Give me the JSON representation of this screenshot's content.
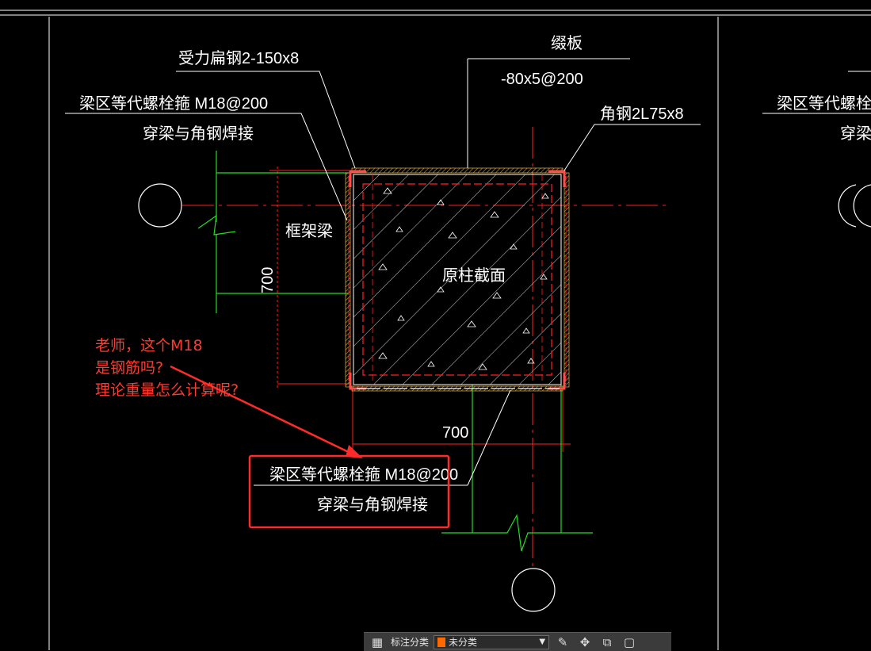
{
  "drawing": {
    "labels": {
      "flat_steel": "受力扁钢2-150x8",
      "batten": "缀板",
      "batten_spec": "-80x5@200",
      "angle_steel": "角钢2L75x8",
      "bolt_left_line1": "梁区等代螺栓箍 M18@200",
      "bolt_left_line2": "穿梁与角钢焊接",
      "frame_beam": "框架梁",
      "dim_vertical": "700",
      "original_section": "原柱截面",
      "dim_horizontal": "700",
      "bolt_bottom_line1": "梁区等代螺栓箍 M18@200",
      "bolt_bottom_line2": "穿梁与角钢焊接",
      "right_partial_line1": "梁区等代螺栓箍 M",
      "right_partial_line2": "穿梁与"
    },
    "colors": {
      "grid_red": "#ff2020",
      "green": "#22dd22",
      "white": "#ffffff",
      "hatch_orange": "#d4a43a",
      "highlight_box": "#ff2a2a"
    }
  },
  "question_note": {
    "line1": "老师，这个M18",
    "line2": "是钢筋吗?",
    "line3": "理论重量怎么计算呢?"
  },
  "toolbar": {
    "grid_icon": "grid-icon",
    "label": "标注分类",
    "select_value": "未分类",
    "swatch_color": "#ff6a00",
    "icons": [
      "edit-icon",
      "move-icon",
      "copy-icon",
      "paste-icon"
    ]
  }
}
